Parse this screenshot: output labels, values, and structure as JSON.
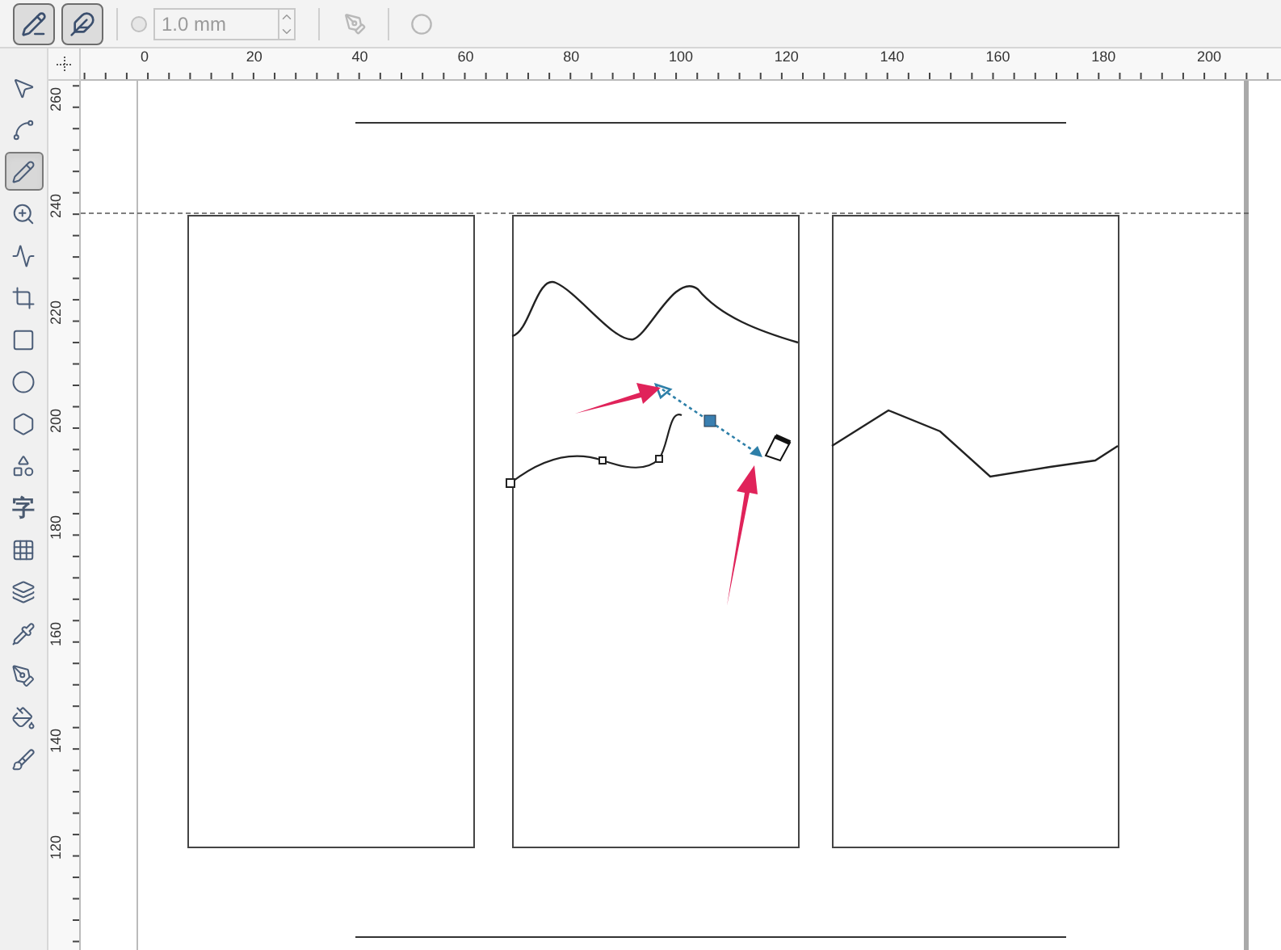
{
  "property_bar": {
    "buttons": [
      {
        "kind": "auto-close",
        "selected": true
      },
      {
        "kind": "pen-option",
        "selected": true
      }
    ],
    "outline_width": {
      "value": "1.0 mm",
      "disabled": true
    },
    "extra_buttons": [
      {
        "kind": "pen-tool",
        "disabled": true
      },
      {
        "kind": "circle",
        "disabled": true
      }
    ]
  },
  "toolbox": [
    {
      "kind": "pointer",
      "selected": false
    },
    {
      "kind": "shape",
      "selected": false
    },
    {
      "kind": "freehand",
      "selected": true
    },
    {
      "kind": "zoom",
      "selected": false
    },
    {
      "kind": "smart",
      "selected": false
    },
    {
      "kind": "crop",
      "selected": false
    },
    {
      "kind": "rectangle",
      "selected": false
    },
    {
      "kind": "ellipse",
      "selected": false
    },
    {
      "kind": "polygon",
      "selected": false
    },
    {
      "kind": "shapes",
      "selected": false
    },
    {
      "kind": "text",
      "label": "字",
      "selected": false
    },
    {
      "kind": "table",
      "selected": false
    },
    {
      "kind": "effects",
      "selected": false
    },
    {
      "kind": "eyedropper",
      "selected": false
    },
    {
      "kind": "outline",
      "selected": false
    },
    {
      "kind": "fill",
      "selected": false
    },
    {
      "kind": "interactive-fill",
      "selected": false
    }
  ],
  "horizontal_ruler": [
    "0",
    "20",
    "40",
    "60",
    "80",
    "100",
    "120",
    "140",
    "160",
    "180",
    "200"
  ],
  "vertical_ruler": [
    "260",
    "240",
    "220",
    "200",
    "180",
    "160",
    "140",
    "120"
  ]
}
